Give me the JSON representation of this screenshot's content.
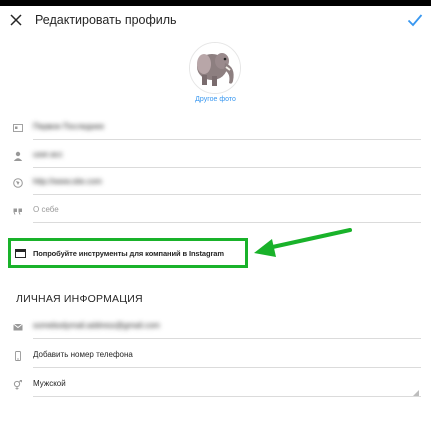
{
  "header": {
    "title": "Редактировать профиль",
    "close_icon": "close-icon",
    "confirm_icon": "check-icon"
  },
  "profile": {
    "change_photo_label": "Другое фото"
  },
  "fields": {
    "name": "Первое Последнее",
    "username": "user.acc",
    "website": "http://www.site.com",
    "bio_placeholder": "О себе"
  },
  "promo": {
    "label": "Попробуйте инструменты для компаний в Instagram"
  },
  "personal": {
    "section_title": "ЛИЧНАЯ ИНФОРМАЦИЯ",
    "email": "somebodymail.address@gmail.com",
    "phone_placeholder": "Добавить номер телефона",
    "gender": "Мужской"
  },
  "colors": {
    "accent": "#3897f0",
    "highlight": "#19b22a"
  }
}
